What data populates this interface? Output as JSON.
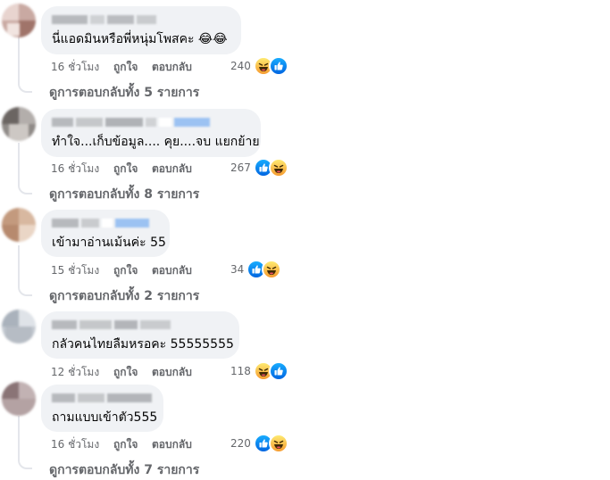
{
  "labels": {
    "like": "ถูกใจ",
    "reply": "ตอบกลับ"
  },
  "comments": [
    {
      "text": "นี่แอดมินหรือพี่หนุ่มโพสคะ 😂😂",
      "time": "16 ชั่วโมง",
      "reactions": 240,
      "reaction_icons": [
        "haha-icon",
        "like-icon"
      ],
      "replies_text": "ดูการตอบกลับทั้ง 5 รายการ"
    },
    {
      "text": "ทำใจ...เก็บข้อมูล.... คุย....จบ แยกย้าย",
      "time": "16 ชั่วโมง",
      "reactions": 267,
      "reaction_icons": [
        "like-icon",
        "haha-icon"
      ],
      "replies_text": "ดูการตอบกลับทั้ง 8 รายการ"
    },
    {
      "text": "เข้ามาอ่านเม้นค่ะ 55",
      "time": "15 ชั่วโมง",
      "reactions": 34,
      "reaction_icons": [
        "like-icon",
        "haha-icon"
      ],
      "replies_text": "ดูการตอบกลับทั้ง 2 รายการ"
    },
    {
      "text": "กลัวคนไทยลืมหรอคะ 55555555",
      "time": "12 ชั่วโมง",
      "reactions": 118,
      "reaction_icons": [
        "haha-icon",
        "like-icon"
      ],
      "replies_text": ""
    },
    {
      "text": "ถามแบบเข้าตัว555",
      "time": "16 ชั่วโมง",
      "reactions": 220,
      "reaction_icons": [
        "like-icon",
        "haha-icon"
      ],
      "replies_text": "ดูการตอบกลับทั้ง 7 รายการ"
    }
  ],
  "colors": {
    "bubble": "#f0f2f5",
    "meta": "#65676b",
    "like": "#0866ff",
    "haha": "#f7b125"
  }
}
